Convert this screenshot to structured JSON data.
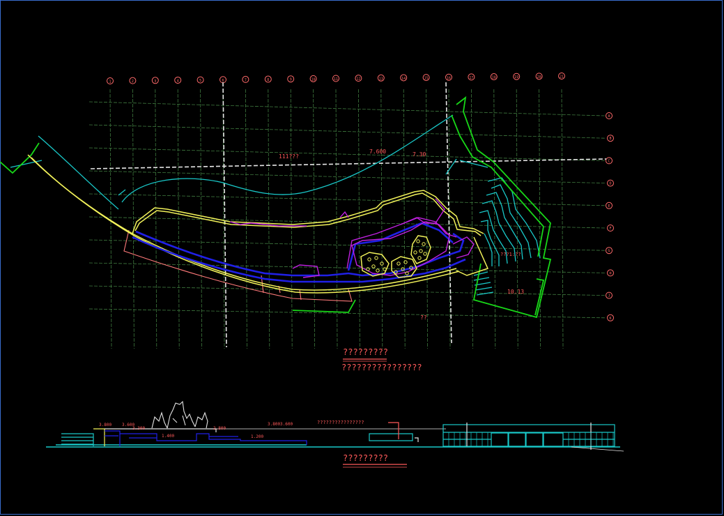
{
  "colors": {
    "background": "#000000",
    "grid": "#3f7a3f",
    "axis_white": "#e6e6e6",
    "bubble": "#ff6a6a",
    "cyan": "#19c8c8",
    "yellow": "#f2f25a",
    "blue": "#2020e6",
    "magenta": "#c020e0",
    "green": "#18d818",
    "pink": "#ff7a7a",
    "red_text": "#ff5a5a",
    "frame": "#3a6fd0"
  },
  "grid": {
    "columns": [
      "1",
      "2",
      "3",
      "4",
      "5",
      "6",
      "7",
      "8",
      "9",
      "10",
      "11",
      "12",
      "13",
      "14",
      "15",
      "16",
      "17",
      "18",
      "19",
      "20",
      "21"
    ],
    "rows": [
      "A",
      "B",
      "C",
      "D",
      "E",
      "F",
      "G",
      "H",
      "J",
      "K"
    ]
  },
  "plan_labels": {
    "center_note": "111???",
    "elevation_1": "7.600",
    "elevation_2": "7.30",
    "stair_note": "???1:??",
    "elevation_3": "10.13",
    "small_note": "??"
  },
  "plan_title": {
    "main": "?????????",
    "sub": "????????????????"
  },
  "section": {
    "levels": [
      "3.800",
      "3.600",
      "3.300",
      "1.400",
      "2.800",
      "1.200",
      "3.800",
      "3.600"
    ],
    "long_note": "????????????????",
    "title": "?????????"
  }
}
